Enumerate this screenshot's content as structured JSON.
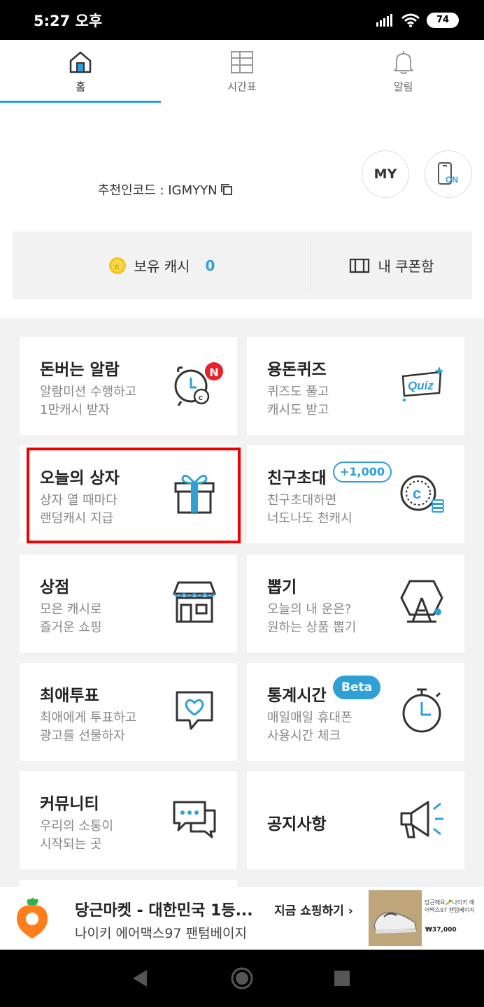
{
  "status": {
    "time": "5:27 오후",
    "battery": "74"
  },
  "tabs": [
    {
      "label": "홈",
      "icon": "home-icon",
      "active": true
    },
    {
      "label": "시간표",
      "icon": "timetable-icon",
      "active": false
    },
    {
      "label": "알림",
      "icon": "bell-icon",
      "active": false
    }
  ],
  "profile": {
    "referral_label": "추천인코드 : IGMYYN",
    "my_button": "MY",
    "screen_on_icon": "phone-on-icon"
  },
  "cash": {
    "label": "보유 캐시",
    "value": "0",
    "coupon_label": "내 쿠폰함"
  },
  "menu": [
    {
      "title": "돈버는 알람",
      "desc1": "알람미션 수행하고",
      "desc2": "1만캐시 받자",
      "icon": "alarm-clock-icon",
      "badge": "N"
    },
    {
      "title": "용돈퀴즈",
      "desc1": "퀴즈도 풀고",
      "desc2": "캐시도 받고",
      "icon": "quiz-icon",
      "icon_text": "Quiz"
    },
    {
      "title": "오늘의 상자",
      "desc1": "상자 열 때마다",
      "desc2": "랜덤캐시 지급",
      "icon": "gift-box-icon"
    },
    {
      "title": "친구초대",
      "desc1": "친구초대하면",
      "desc2": "너도나도 천캐시",
      "icon": "coin-stack-icon",
      "badge": "+1,000"
    },
    {
      "title": "상점",
      "desc1": "모은 캐시로",
      "desc2": "즐거운 쇼핑",
      "icon": "store-icon"
    },
    {
      "title": "뽑기",
      "desc1": "오늘의 내 운은?",
      "desc2": "원하는 상품 뽑기",
      "icon": "gacha-machine-icon"
    },
    {
      "title": "최애투표",
      "desc1": "최애에게 투표하고",
      "desc2": "광고를 선물하자",
      "icon": "heart-chat-icon"
    },
    {
      "title": "통계시간",
      "desc1": "매일매일 휴대폰",
      "desc2": "사용시간 체크",
      "icon": "stopwatch-icon",
      "badge": "Beta"
    },
    {
      "title": "커뮤니티",
      "desc1": "우리의 소통이",
      "desc2": "시작되는 곳",
      "icon": "chat-bubbles-icon"
    },
    {
      "title": "공지사항",
      "desc1": "",
      "desc2": "",
      "icon": "megaphone-icon"
    }
  ],
  "ad": {
    "title": "당근마켓 - 대한민국 1등...",
    "subtitle": "나이키 에어맥스97 팬텀베이지",
    "cta": "지금 쇼핑하기",
    "thumb_text": "당근해요🥕나이키 에어맥스97 팬텀베이지",
    "price": "₩37,000",
    "logo_icon": "carrot-logo-icon"
  },
  "colors": {
    "accent": "#2fa0d6",
    "highlight": "#ee0000",
    "badge_red": "#e8212b"
  }
}
